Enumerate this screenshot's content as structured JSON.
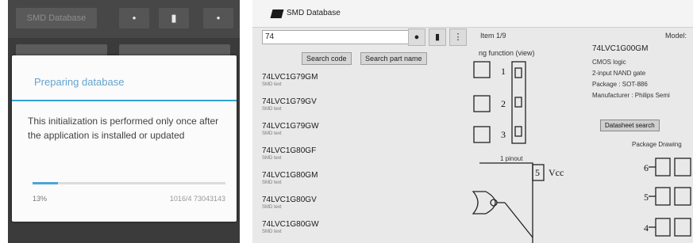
{
  "phone": {
    "app_name": "SMD Database",
    "buttons": [
      {
        "icon": "search-icon",
        "glyph": "•"
      },
      {
        "icon": "phone-icon",
        "glyph": "▮"
      },
      {
        "icon": "overflow-menu-icon",
        "glyph": "•"
      }
    ],
    "dialog": {
      "title": "Preparing database",
      "message": "This initialization is performed only once after the application is installed or updated",
      "progress_fraction": 0.13,
      "percent_text": "13%",
      "count_text": "1016/4 73043143"
    }
  },
  "desktop": {
    "window_title": "SMD Database",
    "search_value": "74",
    "toolbar_buttons": [
      {
        "icon": "search-icon",
        "glyph": "●"
      },
      {
        "icon": "phone-icon",
        "glyph": "▮"
      },
      {
        "icon": "overflow-menu-icon",
        "glyph": "⋮"
      }
    ],
    "item_count": "Item 1/9",
    "model_label": "Model:",
    "search_code_button": "Search code",
    "search_part_button": "Search part name",
    "parts": [
      {
        "name": "74LVC1G79GM",
        "sub": "SMD text"
      },
      {
        "name": "74LVC1G79GV",
        "sub": "SMD text"
      },
      {
        "name": "74LVC1G79GW",
        "sub": "SMD text"
      },
      {
        "name": "74LVC1G80GF",
        "sub": "SMD text"
      },
      {
        "name": "74LVC1G80GM",
        "sub": "SMD text"
      },
      {
        "name": "74LVC1G80GV",
        "sub": "SMD text"
      },
      {
        "name": "74LVC1G80GW",
        "sub": "SMD text"
      }
    ],
    "canvas_title": "ng function (view)",
    "function_pins": [
      "1",
      "2",
      "3"
    ],
    "pin_label": "1 pinout",
    "vcc_pin_number": "5",
    "vcc_text": "Vcc",
    "description": {
      "title": "74LVC1G00GM",
      "lines": [
        "CMOS logic",
        "2-input NAND gate",
        "Package : SOT-886",
        "Manufacturer : Philips Semi"
      ]
    },
    "datasheet_button": "Datasheet search",
    "package_label": "Package Drawing",
    "package_pins": [
      "6",
      "5",
      "4"
    ]
  }
}
